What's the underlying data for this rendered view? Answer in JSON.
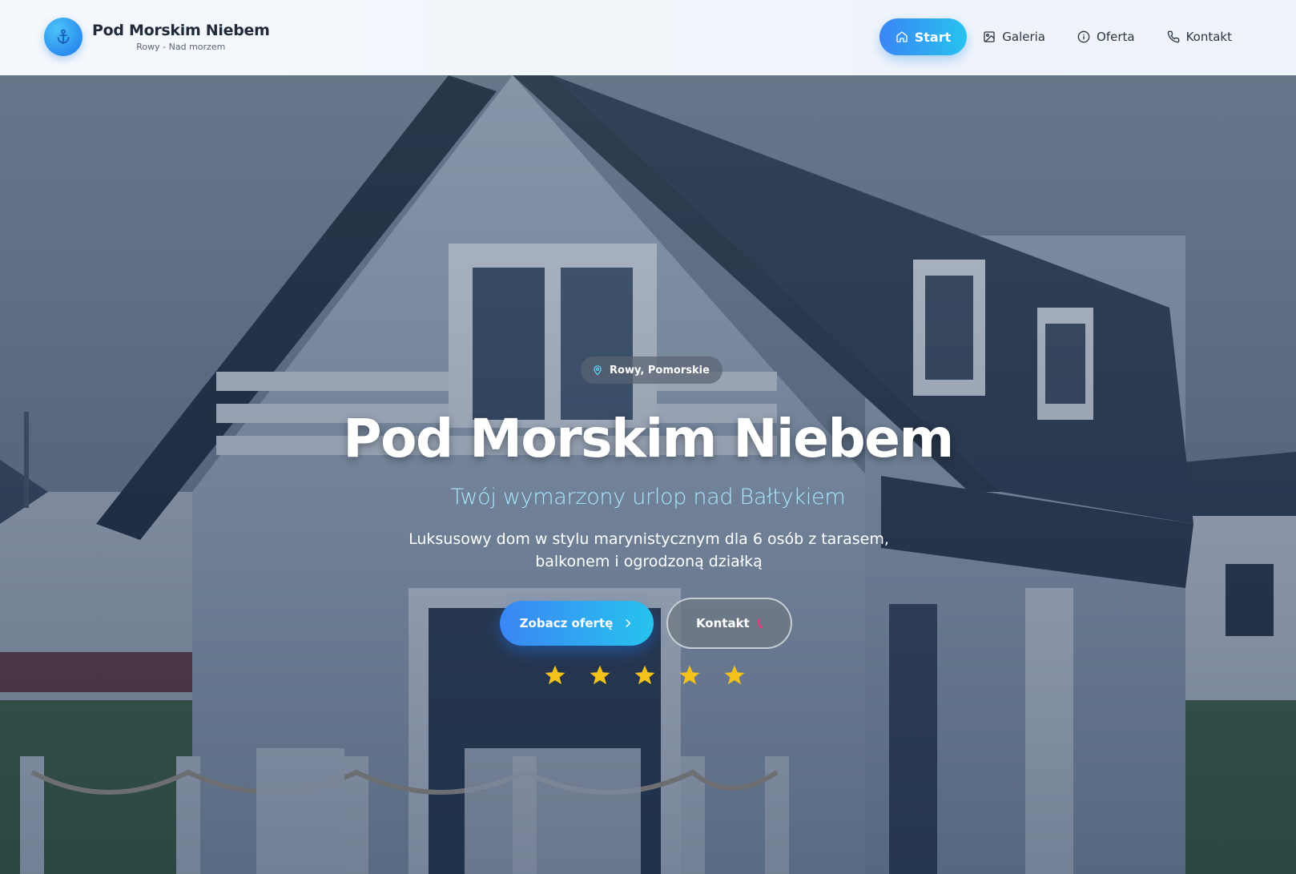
{
  "brand": {
    "title": "Pod Morskim Niebem",
    "subtitle": "Rowy - Nad morzem",
    "logo_icon": "anchor-icon"
  },
  "nav": {
    "items": [
      {
        "label": "Start",
        "icon": "home-icon",
        "active": true
      },
      {
        "label": "Galeria",
        "icon": "image-icon",
        "active": false
      },
      {
        "label": "Oferta",
        "icon": "info-icon",
        "active": false
      },
      {
        "label": "Kontakt",
        "icon": "phone-icon",
        "active": false
      }
    ]
  },
  "hero": {
    "location": "Rowy, Pomorskie",
    "location_icon": "map-pin-icon",
    "title": "Pod Morskim Niebem",
    "subtitle": "Twój wymarzony urlop nad Bałtykiem",
    "description": "Luksusowy dom w stylu marynistycznym dla 6 osób z tarasem, balkonem i ogrodzoną działką",
    "primary_button": "Zobacz ofertę",
    "secondary_button": "Kontakt",
    "rating_stars": 5
  },
  "colors": {
    "accent_start": "#3a86f5",
    "accent_end": "#27c3ee",
    "star": "#f2c21b",
    "subtitle": "#a8e6ff"
  }
}
